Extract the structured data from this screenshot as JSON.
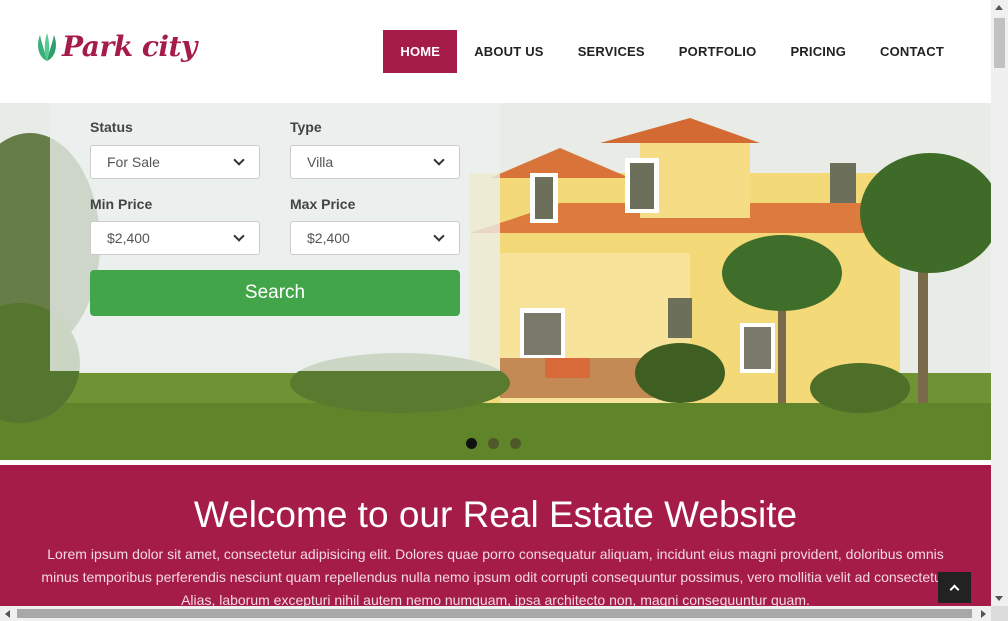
{
  "brand": {
    "name": "Park city",
    "logo_icon": "leaf-logo-icon",
    "color": "#a51c48"
  },
  "nav": {
    "items": [
      {
        "label": "HOME",
        "active": true
      },
      {
        "label": "ABOUT US",
        "active": false
      },
      {
        "label": "SERVICES",
        "active": false
      },
      {
        "label": "PORTFOLIO",
        "active": false
      },
      {
        "label": "PRICING",
        "active": false
      },
      {
        "label": "CONTACT",
        "active": false
      }
    ]
  },
  "search": {
    "status_label": "Status",
    "status_value": "For Sale",
    "type_label": "Type",
    "type_value": "Villa",
    "min_price_label": "Min Price",
    "min_price_value": "$2,400",
    "max_price_label": "Max Price",
    "max_price_value": "$2,400",
    "button_label": "Search",
    "button_color": "#43a54a"
  },
  "slider": {
    "slide_count": 3,
    "active_slide": 1
  },
  "welcome": {
    "title": "Welcome to our Real Estate Website",
    "body": "Lorem ipsum dolor sit amet, consectetur adipisicing elit. Dolores quae porro consequatur aliquam, incidunt eius magni provident, doloribus omnis minus temporibus perferendis nesciunt quam repellendus nulla nemo ipsum odit corrupti consequuntur possimus, vero mollitia velit ad consectetur. Alias, laborum excepturi nihil autem nemo numquam, ipsa architecto non, magni consequuntur quam."
  },
  "back_to_top_icon": "chevron-up-icon"
}
